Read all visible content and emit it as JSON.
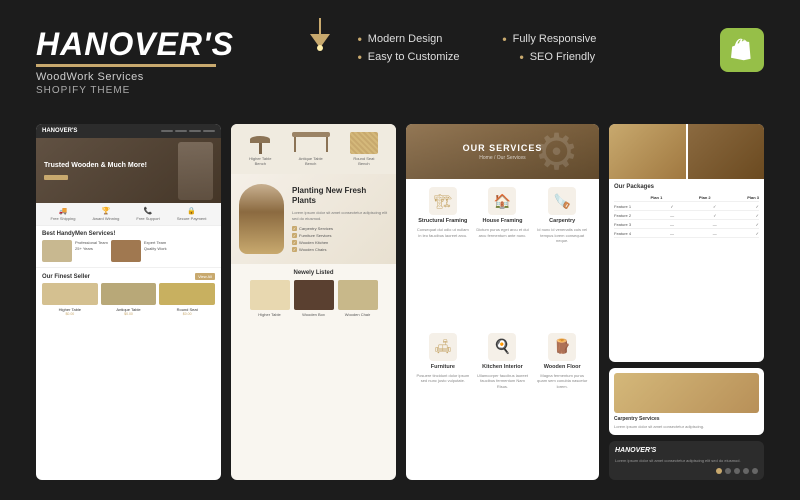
{
  "brand": {
    "title": "HANOVER'S",
    "subtitle": "WoodWork Services",
    "tag": "SHOPIFY THEME"
  },
  "features": {
    "col1": [
      {
        "bullet": "•",
        "label": "Modern Design"
      },
      {
        "bullet": "•",
        "label": "Easy to Customize"
      }
    ],
    "col2": [
      {
        "bullet": "•",
        "label": "Fully Responsive"
      },
      {
        "bullet": "•",
        "label": "SEO Friendly"
      }
    ]
  },
  "preview1": {
    "hero_title": "Trusted Wooden & Much More!",
    "features": [
      "Free Shipping",
      "Award Winning",
      "Free Support",
      "Secure Payment"
    ],
    "section_title": "Best HandyMen Services!",
    "section_labels": [
      "Professional Team",
      "25+ Years Of Expe"
    ],
    "products_title": "Our Finest Seller",
    "products": [
      {
        "name": "Higher Table",
        "price": ""
      },
      {
        "name": "Antique Table",
        "price": ""
      },
      {
        "name": "Round Seat Spquare",
        "price": ""
      }
    ]
  },
  "preview2": {
    "top_items": [
      {
        "label": "Higher Table\nBench"
      },
      {
        "label": "Antique Table\nBench"
      },
      {
        "label": "Round Seat\nBench"
      }
    ],
    "hero_title": "Planting New Fresh Plants",
    "hero_body": "Lorem ipsum dolor sit amet consectetur...",
    "checkboxes": [
      "Carpentry Services",
      "Furniture Services",
      "Wooden Kitchen",
      "Wooden Chairs"
    ],
    "newly_title": "Newely Listed",
    "products": [
      {
        "name": "Higher Table",
        "bg": "#e8d8b8"
      },
      {
        "name": "Wooden Box",
        "bg": "#5a4030"
      },
      {
        "name": "Wooden Chair",
        "bg": "#c8b88a"
      }
    ]
  },
  "preview3": {
    "services_title": "OUR SERVICES",
    "breadcrumb": "Home / Our Services",
    "services": [
      {
        "icon": "🏗",
        "name": "Structural Framing",
        "desc": "Consequat dui odio ut nullam in leo faucibus laoreet arcu."
      },
      {
        "icon": "🏠",
        "name": "House Framing",
        "desc": "Dictum purus eget arcu et dui arcu fermentum ante nunc."
      },
      {
        "icon": "🪚",
        "name": "Carpentry",
        "desc": "Id nunc id venenatis cuis vel tempus lorem consequat neque."
      },
      {
        "icon": "🛋",
        "name": "Furniture",
        "desc": "Posuere tincidunt dolor ipsum sed nunc justo vulputate placerat."
      },
      {
        "icon": "🍳",
        "name": "Kitchen Interior",
        "desc": "Ullamcorper faucibus laoreet faucibus fermentum Nam Risus."
      },
      {
        "icon": "🪵",
        "name": "Wooden Floor",
        "desc": "Magna fermentum purus quam sem conubia nascetur lorem lorem."
      }
    ]
  },
  "preview4": {
    "packages_title": "Our Packages",
    "table_headers": [
      "",
      "Plan 1",
      "Plan 2",
      "Plan 3"
    ],
    "table_rows": [
      {
        "label": "Feature 1",
        "vals": [
          "✓",
          "✓",
          "✓"
        ]
      },
      {
        "label": "Feature 2",
        "vals": [
          "✗",
          "✓",
          "✓"
        ]
      },
      {
        "label": "Feature 3",
        "vals": [
          "✗",
          "✗",
          "✓"
        ]
      },
      {
        "label": "Feature 4",
        "vals": [
          "✗",
          "✗",
          "✓"
        ]
      }
    ],
    "bottom_logo": "HANOVER'S",
    "bottom_text": "Lorem ipsum dolor sit amet consectetur adipiscing elit sed do eiusmod.",
    "dots": [
      {
        "color": "#c8a96e"
      },
      {
        "color": "#888888"
      },
      {
        "color": "#888888"
      },
      {
        "color": "#888888"
      },
      {
        "color": "#888888"
      }
    ]
  }
}
